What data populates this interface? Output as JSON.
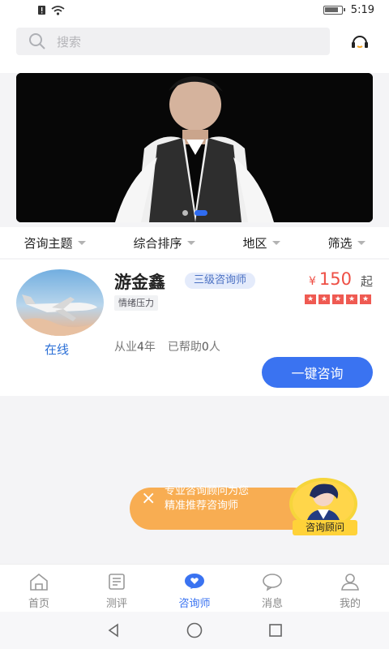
{
  "status": {
    "time": "5:19",
    "icons": [
      "sim-alert-icon",
      "wifi-icon",
      "battery-icon"
    ]
  },
  "search": {
    "placeholder": "搜索"
  },
  "banner": {
    "slide_count": 2,
    "active_slide": 2
  },
  "filters": [
    {
      "label": "咨询主题"
    },
    {
      "label": "综合排序"
    },
    {
      "label": "地区"
    },
    {
      "label": "筛选"
    }
  ],
  "counselor": {
    "name": "游金鑫",
    "level": "三级咨询师",
    "tag": "情绪压力",
    "status": "在线",
    "price_symbol": "¥",
    "price": "150",
    "price_suffix": "起",
    "rating": 5,
    "years_prefix": "从业",
    "years": "4",
    "years_suffix": "年",
    "helped_prefix": "已帮助",
    "helped": "0",
    "helped_suffix": "人",
    "button": "一键咨询"
  },
  "advisor_prompt": {
    "line1": "专业咨询顾问为您",
    "line2": "精准推荐咨询师",
    "label": "咨询顾问"
  },
  "tabs": [
    {
      "label": "首页"
    },
    {
      "label": "测评"
    },
    {
      "label": "咨询师"
    },
    {
      "label": "消息"
    },
    {
      "label": "我的"
    }
  ],
  "colors": {
    "primary": "#3a73f1",
    "price": "#ee4f45",
    "online": "#2b6fd6",
    "advisor": "#f8ad52",
    "advisor_label": "#ffd239"
  }
}
